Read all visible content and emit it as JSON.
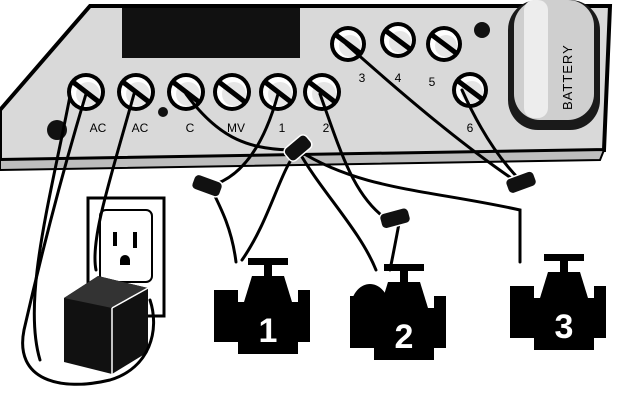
{
  "panel": {
    "terminals_left": [
      "AC",
      "AC",
      "C",
      "MV",
      "1",
      "2"
    ],
    "terminals_right": [
      "3",
      "4",
      "5",
      "6"
    ],
    "battery_label": "BATTERY"
  },
  "valves": [
    {
      "number": "1"
    },
    {
      "number": "2"
    },
    {
      "number": "3"
    }
  ],
  "colors": {
    "panel": "#d9d9d9",
    "outline": "#000000",
    "screw": "#ffffff",
    "valve": "#000000"
  },
  "icons": [
    "outlet-icon",
    "power-adapter-icon",
    "wire-nut-icon",
    "screw-terminal-icon",
    "battery-icon",
    "valve-icon"
  ]
}
